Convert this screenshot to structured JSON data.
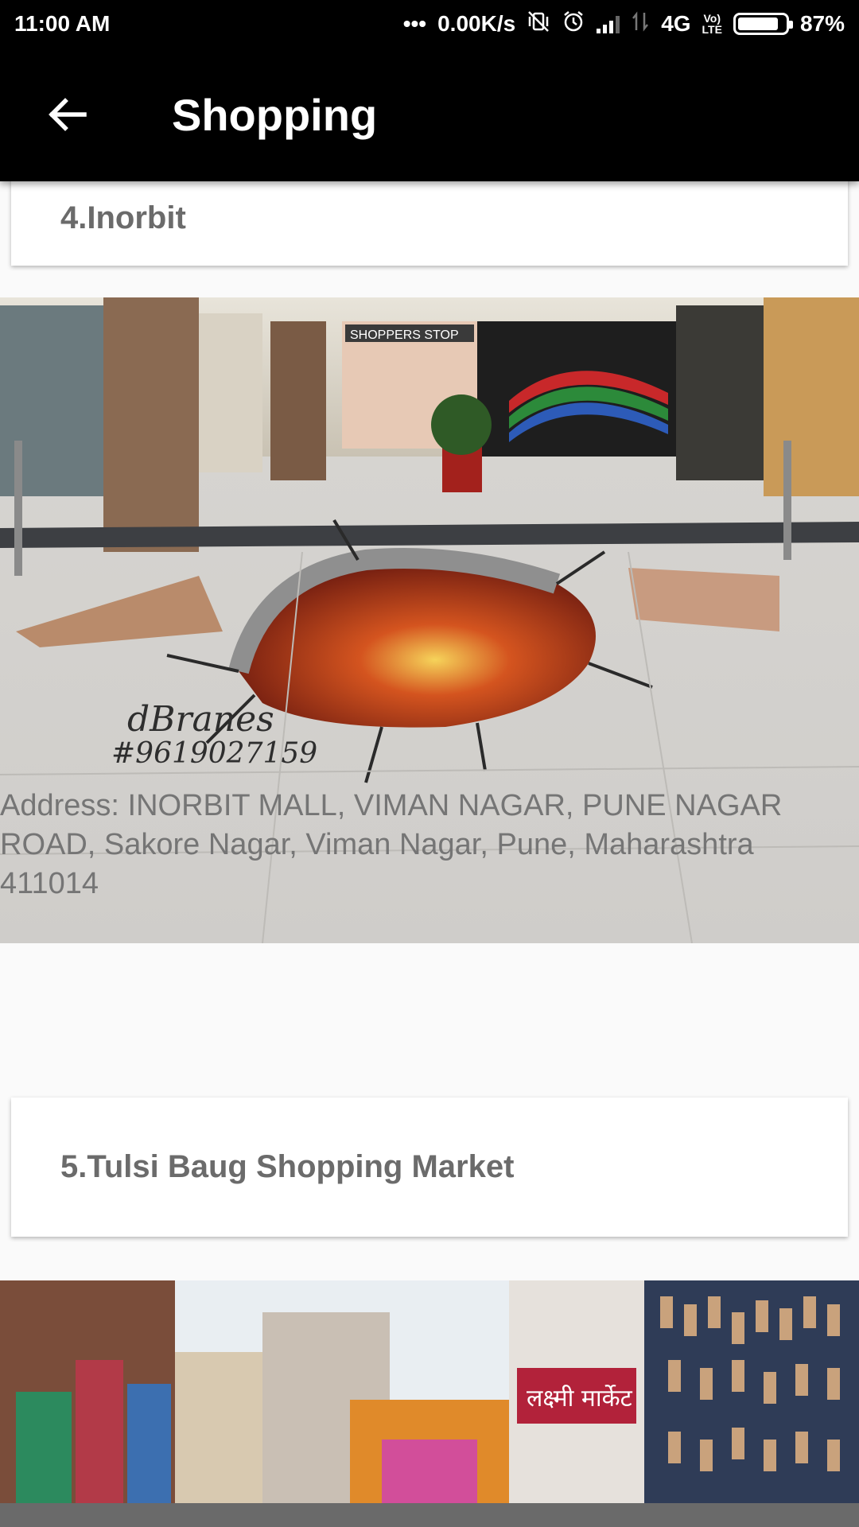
{
  "status_bar": {
    "time": "11:00 AM",
    "more": "•••",
    "net_speed": "0.00K/s",
    "network": "4G",
    "volte_top": "Vo)",
    "volte_bottom": "LTE",
    "battery_percent": "87%",
    "battery_level": 0.87
  },
  "app_bar": {
    "title": "Shopping",
    "back_icon": "arrow-back-icon"
  },
  "places": [
    {
      "title": "4.Inorbit",
      "image_caption_line1": "dBranes",
      "image_caption_line2": "#9619027159",
      "image_sign": "SHOPPERS STOP",
      "address": "Address: INORBIT MALL, VIMAN NAGAR, PUNE NAGAR ROAD, Sakore Nagar, Viman Nagar, Pune, Maharashtra 411014"
    },
    {
      "title": "5.Tulsi Baug Shopping Market",
      "image_sign": "लक्ष्मी मार्केट"
    }
  ]
}
